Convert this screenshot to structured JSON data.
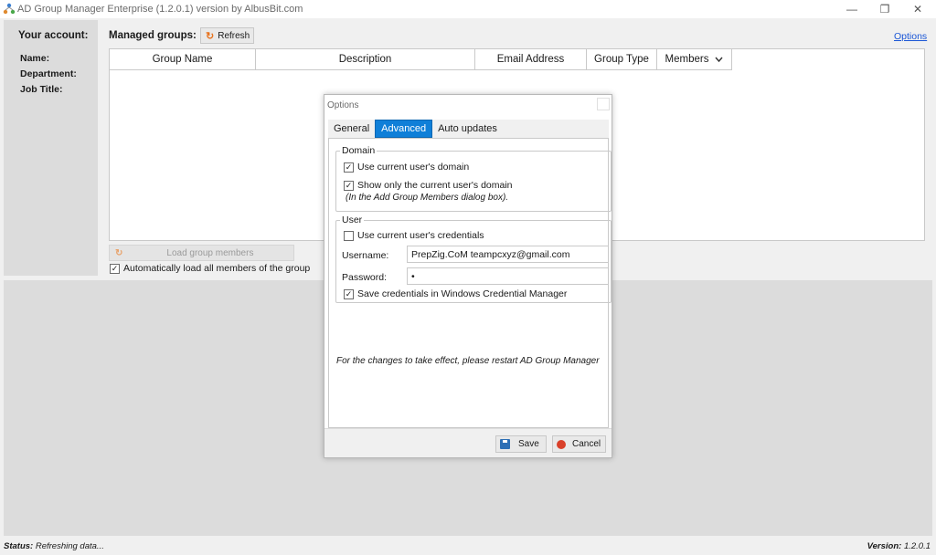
{
  "window": {
    "title": "AD Group Manager Enterprise (1.2.0.1) version by AlbusBit.com",
    "minimize": "—",
    "maximize": "❐",
    "close": "✕"
  },
  "account": {
    "heading": "Your account:",
    "name_label": "Name:",
    "department_label": "Department:",
    "job_title_label": "Job Title:"
  },
  "groups": {
    "label": "Managed groups:",
    "refresh_label": "Refresh",
    "options_link": "Options",
    "columns": [
      "Group Name",
      "Description",
      "Email Address",
      "Group Type",
      "Members"
    ],
    "members_sort_icon": "chevron-down",
    "load_members_label": "Load group members",
    "auto_load_label": "Automatically load all members of the group",
    "auto_load_checked": true
  },
  "dialog": {
    "title": "Options",
    "tabs": [
      "General",
      "Advanced",
      "Auto updates"
    ],
    "active_tab": "Advanced",
    "domain": {
      "legend": "Domain",
      "use_current_domain_label": "Use current user's domain",
      "use_current_domain_checked": true,
      "show_only_domain_label": "Show only the current user's domain",
      "show_only_domain_checked": true,
      "show_only_note": "(In the Add Group Members dialog box)."
    },
    "user": {
      "legend": "User",
      "use_current_credentials_label": "Use current user's credentials",
      "use_current_credentials_checked": false,
      "username_label": "Username:",
      "username_value": "PrepZig.CoM  teampcxyz@gmail.com",
      "password_label": "Password:",
      "password_value": "•",
      "save_credentials_label": "Save credentials in Windows Credential Manager",
      "save_credentials_checked": true
    },
    "restart_note": "For the changes to take effect, please restart AD Group Manager",
    "save_label": "Save",
    "cancel_label": "Cancel"
  },
  "status": {
    "label": "Status:",
    "text": "Refreshing data...",
    "version_label": "Version:",
    "version": "1.2.0.1"
  },
  "colors": {
    "accent": "#0f7fd8",
    "panel": "#dcdcdc",
    "background": "#f0f0f0",
    "refresh_icon": "#e8721c",
    "link": "#1a56d6"
  }
}
